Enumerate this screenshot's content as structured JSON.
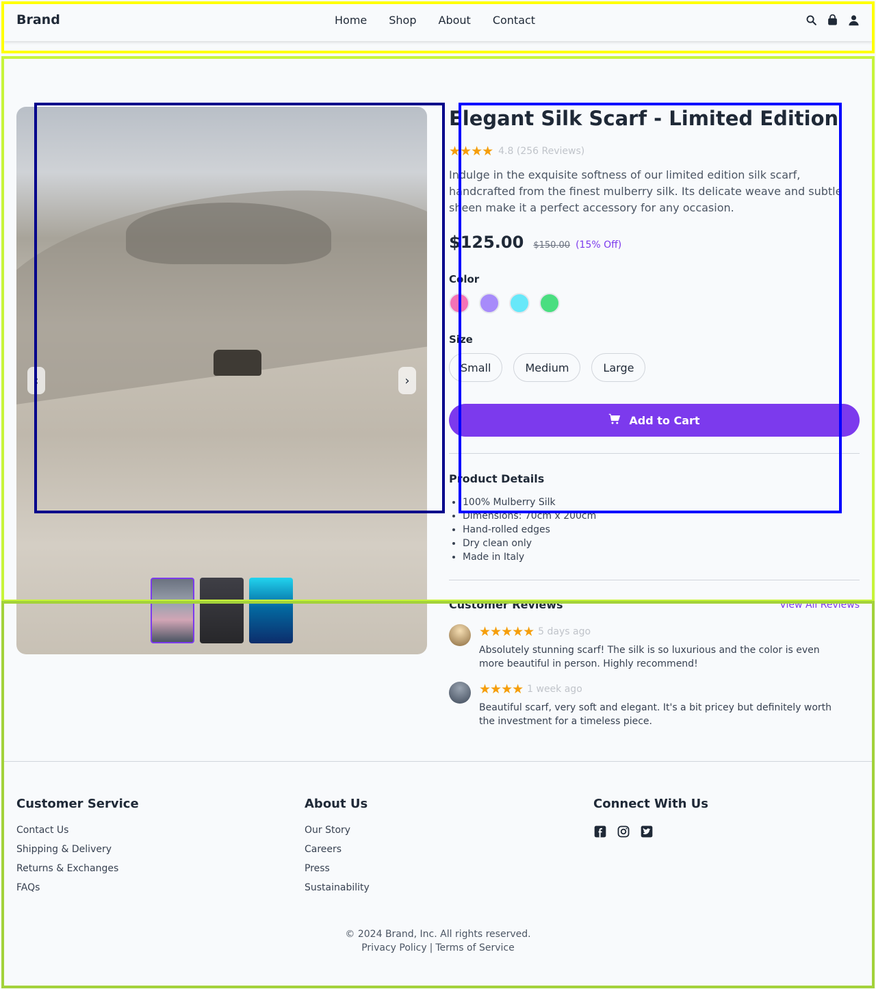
{
  "header": {
    "brand": "Brand",
    "nav": [
      "Home",
      "Shop",
      "About",
      "Contact"
    ],
    "icons": [
      "search-icon",
      "bag-icon",
      "user-icon"
    ]
  },
  "product": {
    "title": "Elegant Silk Scarf - Limited Edition",
    "rating": {
      "stars": "★★★★",
      "text": "4.8 (256 Reviews)"
    },
    "description": "Indulge in the exquisite softness of our limited edition silk scarf, handcrafted from the finest mulberry silk. Its delicate weave and subtle sheen make it a perfect accessory for any occasion.",
    "price": "$125.00",
    "old_price": "$150.00",
    "discount": "(15% Off)",
    "color_label": "Color",
    "colors": [
      "#f472b6",
      "#a78bfa",
      "#67e8f9",
      "#4ade80"
    ],
    "size_label": "Size",
    "sizes": [
      "Small",
      "Medium",
      "Large"
    ],
    "cart_button": "Add to Cart",
    "gallery": {
      "prev": "‹",
      "next": "›"
    }
  },
  "details": {
    "title": "Product Details",
    "items": [
      "100% Mulberry Silk",
      "Dimensions: 70cm x 200cm",
      "Hand-rolled edges",
      "Dry clean only",
      "Made in Italy"
    ]
  },
  "reviews": {
    "title": "Customer Reviews",
    "view_all": "View All Reviews",
    "items": [
      {
        "stars": "★★★★★",
        "time": "5 days ago",
        "text": "Absolutely stunning scarf! The silk is so luxurious and the color is even more beautiful in person. Highly recommend!"
      },
      {
        "stars": "★★★★",
        "time": "1 week ago",
        "text": "Beautiful scarf, very soft and elegant. It's a bit pricey but definitely worth the investment for a timeless piece."
      }
    ]
  },
  "footer": {
    "customer_service": {
      "title": "Customer Service",
      "links": [
        "Contact Us",
        "Shipping & Delivery",
        "Returns & Exchanges",
        "FAQs"
      ]
    },
    "about": {
      "title": "About Us",
      "links": [
        "Our Story",
        "Careers",
        "Press",
        "Sustainability"
      ]
    },
    "connect": {
      "title": "Connect With Us",
      "icons": [
        "facebook-icon",
        "instagram-icon",
        "twitter-icon"
      ]
    },
    "copyright": "© 2024 Brand, Inc. All rights reserved.",
    "privacy": "Privacy Policy",
    "separator": "|",
    "terms": "Terms of Service"
  }
}
